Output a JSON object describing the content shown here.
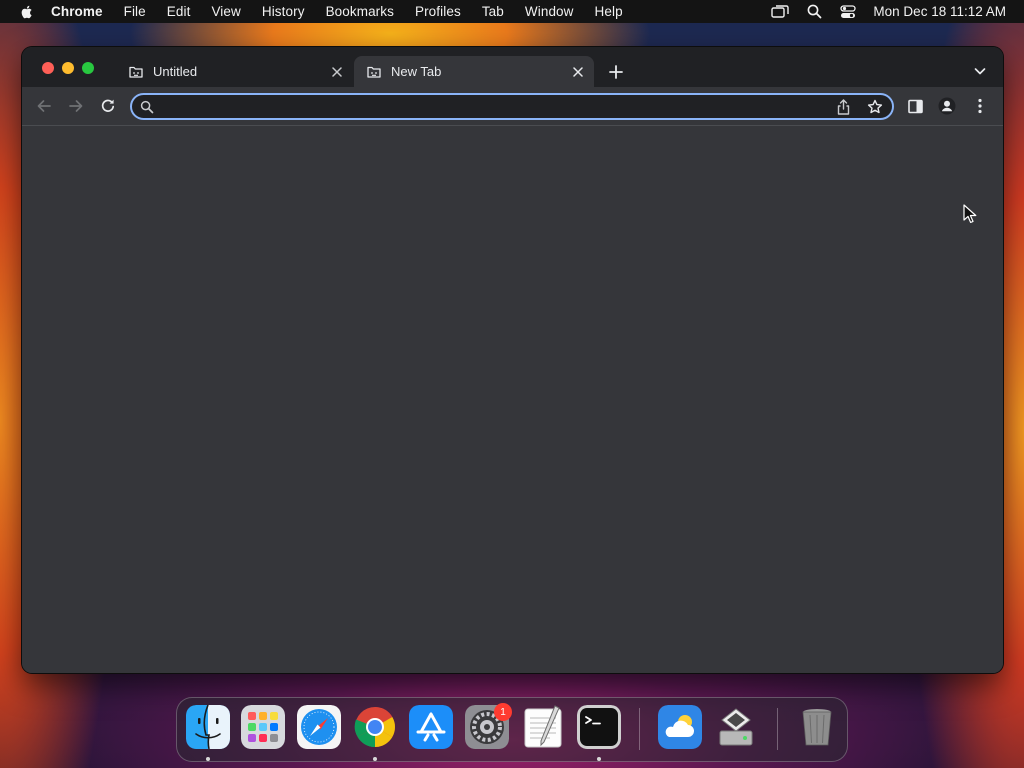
{
  "menubar": {
    "app_name": "Chrome",
    "items": [
      "File",
      "Edit",
      "View",
      "History",
      "Bookmarks",
      "Profiles",
      "Tab",
      "Window",
      "Help"
    ],
    "clock": "Mon Dec 18  11:12 AM",
    "status_icons": [
      "screen-mirroring-icon",
      "spotlight-search-icon",
      "control-center-icon"
    ]
  },
  "browser": {
    "tabs": [
      {
        "title": "Untitled",
        "icon": "tab-favicon-icon",
        "active": false
      },
      {
        "title": "New Tab",
        "icon": "tab-favicon-icon",
        "active": true
      }
    ],
    "omnibox": {
      "value": "",
      "placeholder": ""
    },
    "toolbar_icons": [
      "back-arrow-icon",
      "forward-arrow-icon",
      "reload-icon",
      "share-icon",
      "bookmark-star-icon",
      "side-panel-icon",
      "profile-icon",
      "more-menu-icon"
    ],
    "colors": {
      "frame": "#202124",
      "toolbar": "#35363a",
      "focus_ring": "#8ab4f8"
    }
  },
  "dock": {
    "apps": [
      {
        "name": "Finder",
        "icon": "finder-icon",
        "running": true
      },
      {
        "name": "Launchpad",
        "icon": "launchpad-icon",
        "running": false
      },
      {
        "name": "Safari",
        "icon": "safari-icon",
        "running": false
      },
      {
        "name": "Google Chrome",
        "icon": "chrome-icon",
        "running": true
      },
      {
        "name": "App Store",
        "icon": "app-store-icon",
        "running": false
      },
      {
        "name": "System Settings",
        "icon": "system-settings-icon",
        "running": false,
        "badge": "1"
      },
      {
        "name": "TextEdit",
        "icon": "textedit-icon",
        "running": false
      },
      {
        "name": "Terminal",
        "icon": "terminal-icon",
        "running": true
      },
      {
        "name": "Weather",
        "icon": "weather-icon",
        "running": false
      },
      {
        "name": "Disk Utility",
        "icon": "disk-utility-icon",
        "running": false
      },
      {
        "name": "Trash",
        "icon": "trash-icon",
        "running": false
      }
    ]
  }
}
